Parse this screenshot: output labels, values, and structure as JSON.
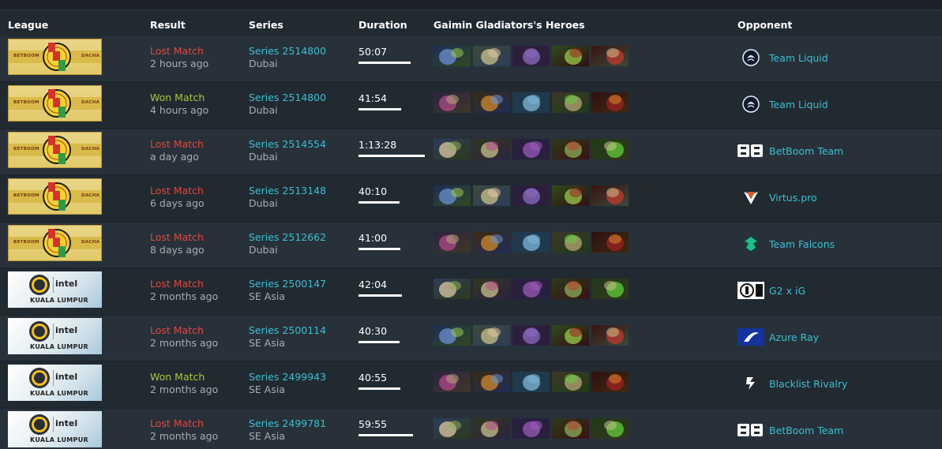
{
  "header": {
    "league": "League",
    "result": "Result",
    "series": "Series",
    "duration": "Duration",
    "heroes": "Gaimin Gladiators's Heroes",
    "opponent": "Opponent"
  },
  "colors": {
    "lost": "#e0473f",
    "won": "#a6c83d",
    "link": "#3bbfd2",
    "muted": "#a8adb1"
  },
  "matches": [
    {
      "league": "epl",
      "league_text": {
        "left": "BETBOOM",
        "right": "DACHA"
      },
      "result": "Lost Match",
      "outcome": "lost",
      "ago": "2 hours ago",
      "series": "Series 2514800",
      "region": "Dubai",
      "duration": "50:07",
      "duration_fraction": 0.78,
      "heroes": [
        "hero-icon",
        "hero-icon",
        "hero-icon",
        "hero-icon",
        "hero-icon"
      ],
      "opponent": "Team Liquid",
      "opponent_icon": "team-liquid-icon"
    },
    {
      "league": "epl",
      "league_text": {
        "left": "BETBOOM",
        "right": "DACHA"
      },
      "result": "Won Match",
      "outcome": "won",
      "ago": "4 hours ago",
      "series": "Series 2514800",
      "region": "Dubai",
      "duration": "41:54",
      "duration_fraction": 0.64,
      "heroes": [
        "hero-icon",
        "hero-icon",
        "hero-icon",
        "hero-icon",
        "hero-icon"
      ],
      "opponent": "Team Liquid",
      "opponent_icon": "team-liquid-icon"
    },
    {
      "league": "epl",
      "league_text": {
        "left": "BETBOOM",
        "right": "DACHA"
      },
      "result": "Lost Match",
      "outcome": "lost",
      "ago": "a day ago",
      "series": "Series 2514554",
      "region": "Dubai",
      "duration": "1:13:28",
      "duration_fraction": 1.0,
      "heroes": [
        "hero-icon",
        "hero-icon",
        "hero-icon",
        "hero-icon",
        "hero-icon"
      ],
      "opponent": "BetBoom Team",
      "opponent_icon": "betboom-icon"
    },
    {
      "league": "epl",
      "league_text": {
        "left": "BETBOOM",
        "right": "DACHA"
      },
      "result": "Lost Match",
      "outcome": "lost",
      "ago": "6 days ago",
      "series": "Series 2513148",
      "region": "Dubai",
      "duration": "40:10",
      "duration_fraction": 0.62,
      "heroes": [
        "hero-icon",
        "hero-icon",
        "hero-icon",
        "hero-icon",
        "hero-icon"
      ],
      "opponent": "Virtus.pro",
      "opponent_icon": "virtus-pro-icon"
    },
    {
      "league": "epl",
      "league_text": {
        "left": "BETBOOM",
        "right": "DACHA"
      },
      "result": "Lost Match",
      "outcome": "lost",
      "ago": "8 days ago",
      "series": "Series 2512662",
      "region": "Dubai",
      "duration": "41:00",
      "duration_fraction": 0.63,
      "heroes": [
        "hero-icon",
        "hero-icon",
        "hero-icon",
        "hero-icon",
        "hero-icon"
      ],
      "opponent": "Team Falcons",
      "opponent_icon": "team-falcons-icon"
    },
    {
      "league": "esl",
      "league_text": {
        "brand": "ONE",
        "sponsor": "intel",
        "city": "KUALA LUMPUR"
      },
      "result": "Lost Match",
      "outcome": "lost",
      "ago": "2 months ago",
      "series": "Series 2500147",
      "region": "SE Asia",
      "duration": "42:04",
      "duration_fraction": 0.65,
      "heroes": [
        "hero-icon",
        "hero-icon",
        "hero-icon",
        "hero-icon",
        "hero-icon"
      ],
      "opponent": "G2 x iG",
      "opponent_icon": "g2-ig-icon"
    },
    {
      "league": "esl",
      "league_text": {
        "brand": "ONE",
        "sponsor": "intel",
        "city": "KUALA LUMPUR"
      },
      "result": "Lost Match",
      "outcome": "lost",
      "ago": "2 months ago",
      "series": "Series 2500114",
      "region": "SE Asia",
      "duration": "40:30",
      "duration_fraction": 0.62,
      "heroes": [
        "hero-icon",
        "hero-icon",
        "hero-icon",
        "hero-icon",
        "hero-icon"
      ],
      "opponent": "Azure Ray",
      "opponent_icon": "azure-ray-icon"
    },
    {
      "league": "esl",
      "league_text": {
        "brand": "ONE",
        "sponsor": "intel",
        "city": "KUALA LUMPUR"
      },
      "result": "Won Match",
      "outcome": "won",
      "ago": "2 months ago",
      "series": "Series 2499943",
      "region": "SE Asia",
      "duration": "40:55",
      "duration_fraction": 0.63,
      "heroes": [
        "hero-icon",
        "hero-icon",
        "hero-icon",
        "hero-icon",
        "hero-icon"
      ],
      "opponent": "Blacklist Rivalry",
      "opponent_icon": "blacklist-rivalry-icon"
    },
    {
      "league": "esl",
      "league_text": {
        "brand": "ONE",
        "sponsor": "intel",
        "city": "KUALA LUMPUR"
      },
      "result": "Lost Match",
      "outcome": "lost",
      "ago": "2 months ago",
      "series": "Series 2499781",
      "region": "SE Asia",
      "duration": "59:55",
      "duration_fraction": 0.82,
      "heroes": [
        "hero-icon",
        "hero-icon",
        "hero-icon",
        "hero-icon",
        "hero-icon"
      ],
      "opponent": "BetBoom Team",
      "opponent_icon": "betboom-icon"
    }
  ]
}
